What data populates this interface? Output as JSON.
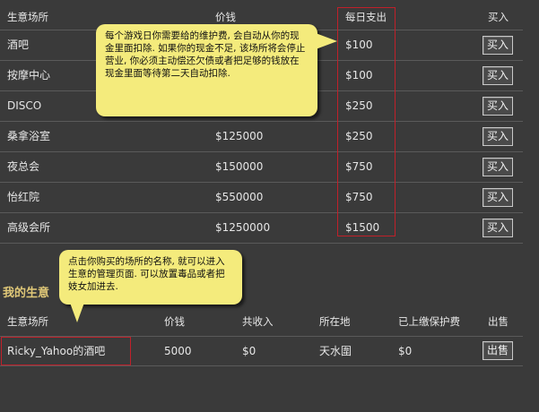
{
  "venues": {
    "headers": {
      "name": "生意场所",
      "price": "价钱",
      "daily": "每日支出",
      "buy": "买入"
    },
    "rows": [
      {
        "name": "酒吧",
        "price": "",
        "daily": "$100",
        "button": "买入"
      },
      {
        "name": "按摩中心",
        "price": "",
        "daily": "$100",
        "button": "买入"
      },
      {
        "name": "DISCO",
        "price": "",
        "daily": "$250",
        "button": "买入"
      },
      {
        "name": "桑拿浴室",
        "price": "$125000",
        "daily": "$250",
        "button": "买入"
      },
      {
        "name": "夜总会",
        "price": "$150000",
        "daily": "$750",
        "button": "买入"
      },
      {
        "name": "怡红院",
        "price": "$550000",
        "daily": "$750",
        "button": "买入"
      },
      {
        "name": "高级会所",
        "price": "$1250000",
        "daily": "$1500",
        "button": "买入"
      }
    ]
  },
  "tooltips": {
    "maintenance": "每个游戏日你需要给的维护费, 会自动从你的现金里面扣除. 如果你的现金不足, 该场所将会停止营业, 你必须主动偿还欠债或者把足够的钱放在现金里面等待第二天自动扣除.",
    "manage": "点击你购买的场所的名称, 就可以进入生意的管理页面. 可以放置毒品或者把妓女加进去."
  },
  "my_business": {
    "title": "我的生意",
    "headers": {
      "name": "生意场所",
      "price": "价钱",
      "income": "共收入",
      "location": "所在地",
      "fee": "已上缴保护费",
      "sell": "出售"
    },
    "rows": [
      {
        "name": "Ricky_Yahoo的酒吧",
        "price": "5000",
        "income": "$0",
        "location": "天水圍",
        "fee": "$0",
        "button": "出售"
      }
    ]
  },
  "colors": {
    "background": "#3a3a3a",
    "tooltip": "#f4eb7c",
    "highlight": "#c0202a",
    "section_title": "#e0c878"
  }
}
